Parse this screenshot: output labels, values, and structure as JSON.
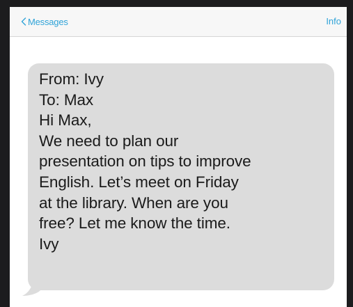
{
  "navbar": {
    "back_label": "Messages",
    "info_label": "Info"
  },
  "message": {
    "lines": [
      "From: Ivy",
      "To: Max",
      "Hi Max,",
      "We need to plan our",
      "presentation on tips to improve",
      "English. Let’s meet on Friday",
      "at the library. When are you",
      "free? Let me know the time.",
      "Ivy"
    ]
  },
  "colors": {
    "accent": "#2fa3d8",
    "bubble": "#dcdcdc",
    "bezel": "#1c1c1e"
  },
  "icons": {
    "back": "chevron-left-icon"
  }
}
